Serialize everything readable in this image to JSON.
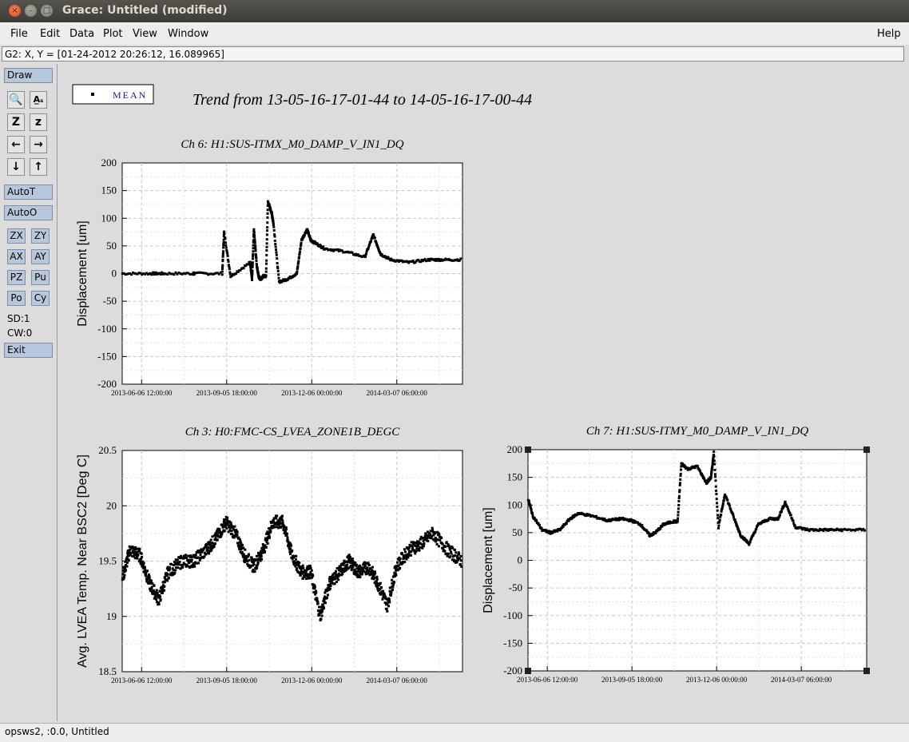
{
  "window": {
    "title": "Grace: Untitled (modified)",
    "close_glyph": "×",
    "min_glyph": "–",
    "max_glyph": "□"
  },
  "menu": {
    "items": [
      "File",
      "Edit",
      "Data",
      "Plot",
      "View",
      "Window"
    ],
    "help": "Help"
  },
  "coords_readout": "G2: X, Y = [01-24-2012 20:26:12, 16.089965]",
  "toolbar": {
    "draw": "Draw",
    "icons": [
      "zoom-icon",
      "autoscale-text-icon",
      "zoom-x-icon",
      "zoom-y-icon",
      "left-arrow-icon",
      "right-arrow-icon",
      "down-arrow-icon",
      "up-arrow-icon"
    ],
    "icon_glyphs": [
      "🔍",
      "A̲ₛ",
      "Z",
      "z",
      "←",
      "→",
      "↓",
      "↑"
    ],
    "autot": "AutoT",
    "autoo": "AutoO",
    "small_buttons": [
      "ZX",
      "ZY",
      "AX",
      "AY",
      "PZ",
      "Pu",
      "Po",
      "Cy"
    ],
    "sd": "SD:1",
    "cw": "CW:0",
    "exit": "Exit"
  },
  "legend": {
    "label": "MEAN"
  },
  "main_title": "Trend from 13-05-16-17-01-44 to 14-05-16-17-00-44",
  "colors": {
    "plot_bg": "#ffffff",
    "data": "#000000",
    "legend_text": "#1a1ab4",
    "canvas": "#dcdcdc",
    "button_blue": "#b8c8dc"
  },
  "chart_data": [
    {
      "type": "scatter",
      "title": "Ch 6: H1:SUS-ITMX_M0_DAMP_V_IN1_DQ",
      "ylabel": "Displacement [um]",
      "xlabel": "",
      "ylim": [
        -200,
        200
      ],
      "yticks": [
        "200",
        "150",
        "100",
        "50",
        "0",
        "-50",
        "-100",
        "-150",
        "-200"
      ],
      "xticks": [
        "2013-06-06 12:00:00",
        "2013-09-05 18:00:00",
        "2013-12-06 00:00:00",
        "2014-03-07 06:00:00"
      ],
      "grid": true,
      "series": [
        {
          "name": "MEAN",
          "x": [
            "2013-05-17",
            "2013-06-15",
            "2013-07-01",
            "2013-08-01",
            "2013-08-02",
            "2013-09-01",
            "2013-09-03",
            "2013-09-10",
            "2013-10-01",
            "2013-10-03",
            "2013-10-05",
            "2013-10-08",
            "2013-10-10",
            "2013-10-12",
            "2013-10-15",
            "2013-10-18",
            "2013-10-20",
            "2013-10-24",
            "2013-10-26",
            "2013-11-01",
            "2013-11-10",
            "2013-11-20",
            "2013-11-25",
            "2013-12-01",
            "2013-12-05",
            "2013-12-10",
            "2013-12-20",
            "2014-01-10",
            "2014-02-01",
            "2014-02-10",
            "2014-02-18",
            "2014-03-01",
            "2014-03-20",
            "2014-04-10",
            "2014-04-25",
            "2014-05-16"
          ],
          "y": [
            0,
            0,
            0,
            0,
            0,
            0,
            75,
            -5,
            20,
            -10,
            80,
            15,
            -5,
            -10,
            -5,
            -5,
            130,
            110,
            90,
            -15,
            -10,
            0,
            60,
            80,
            60,
            55,
            45,
            40,
            30,
            70,
            35,
            25,
            20,
            25,
            25,
            25
          ]
        }
      ]
    },
    {
      "type": "scatter",
      "title": "Ch 3: H0:FMC-CS_LVEA_ZONE1B_DEGC",
      "ylabel": "Avg. LVEA Temp. Near BSC2 [Deg C]",
      "xlabel": "",
      "ylim": [
        18.5,
        20.5
      ],
      "yticks": [
        "20.5",
        "20",
        "19.5",
        "19",
        "18.5"
      ],
      "xticks": [
        "2013-06-06 12:00:00",
        "2013-09-05 18:00:00",
        "2013-12-06 00:00:00",
        "2014-03-07 06:00:00"
      ],
      "grid": true,
      "series": [
        {
          "name": "MEAN",
          "x": [
            "2013-05-17",
            "2013-05-25",
            "2013-06-05",
            "2013-06-15",
            "2013-06-25",
            "2013-07-05",
            "2013-07-20",
            "2013-08-01",
            "2013-08-15",
            "2013-08-25",
            "2013-09-05",
            "2013-09-15",
            "2013-09-25",
            "2013-10-05",
            "2013-10-15",
            "2013-10-25",
            "2013-11-05",
            "2013-11-15",
            "2013-11-25",
            "2013-12-05",
            "2013-12-15",
            "2013-12-25",
            "2014-01-05",
            "2014-01-15",
            "2014-01-25",
            "2014-02-05",
            "2014-02-15",
            "2014-02-25",
            "2014-03-07",
            "2014-03-20",
            "2014-04-01",
            "2014-04-15",
            "2014-05-01",
            "2014-05-16"
          ],
          "y": [
            19.35,
            19.6,
            19.55,
            19.3,
            19.15,
            19.4,
            19.5,
            19.5,
            19.6,
            19.7,
            19.85,
            19.75,
            19.55,
            19.45,
            19.6,
            19.85,
            19.85,
            19.55,
            19.4,
            19.4,
            19.0,
            19.3,
            19.4,
            19.5,
            19.4,
            19.45,
            19.3,
            19.1,
            19.45,
            19.6,
            19.65,
            19.75,
            19.6,
            19.5
          ]
        }
      ]
    },
    {
      "type": "scatter",
      "title": "Ch 7: H1:SUS-ITMY_M0_DAMP_V_IN1_DQ",
      "ylabel": "Displacement [um]",
      "xlabel": "",
      "ylim": [
        -200,
        200
      ],
      "yticks": [
        "200",
        "150",
        "100",
        "50",
        "0",
        "-50",
        "-100",
        "-150",
        "-200"
      ],
      "xticks": [
        "2013-06-06 12:00:00",
        "2013-09-05 18:00:00",
        "2013-12-06 00:00:00",
        "2014-03-07 06:00:00"
      ],
      "grid": true,
      "series": [
        {
          "name": "MEAN",
          "x": [
            "2013-05-17",
            "2013-05-22",
            "2013-06-01",
            "2013-06-10",
            "2013-06-20",
            "2013-07-01",
            "2013-07-10",
            "2013-07-25",
            "2013-08-10",
            "2013-08-25",
            "2013-09-05",
            "2013-09-15",
            "2013-09-25",
            "2013-10-01",
            "2013-10-10",
            "2013-10-20",
            "2013-10-25",
            "2013-10-29",
            "2013-11-05",
            "2013-11-15",
            "2013-11-25",
            "2013-11-30",
            "2013-12-03",
            "2013-12-08",
            "2013-12-15",
            "2013-12-25",
            "2014-01-01",
            "2014-01-10",
            "2014-01-20",
            "2014-02-01",
            "2014-02-10",
            "2014-02-18",
            "2014-03-01",
            "2014-03-15",
            "2014-04-01",
            "2014-04-20",
            "2014-05-16"
          ],
          "y": [
            110,
            80,
            55,
            50,
            55,
            75,
            85,
            80,
            72,
            75,
            72,
            65,
            45,
            50,
            65,
            70,
            70,
            175,
            165,
            170,
            140,
            150,
            195,
            60,
            120,
            75,
            45,
            30,
            65,
            75,
            75,
            105,
            60,
            55,
            55,
            55,
            55
          ]
        }
      ]
    }
  ],
  "status": "opsws2, :0.0, Untitled"
}
